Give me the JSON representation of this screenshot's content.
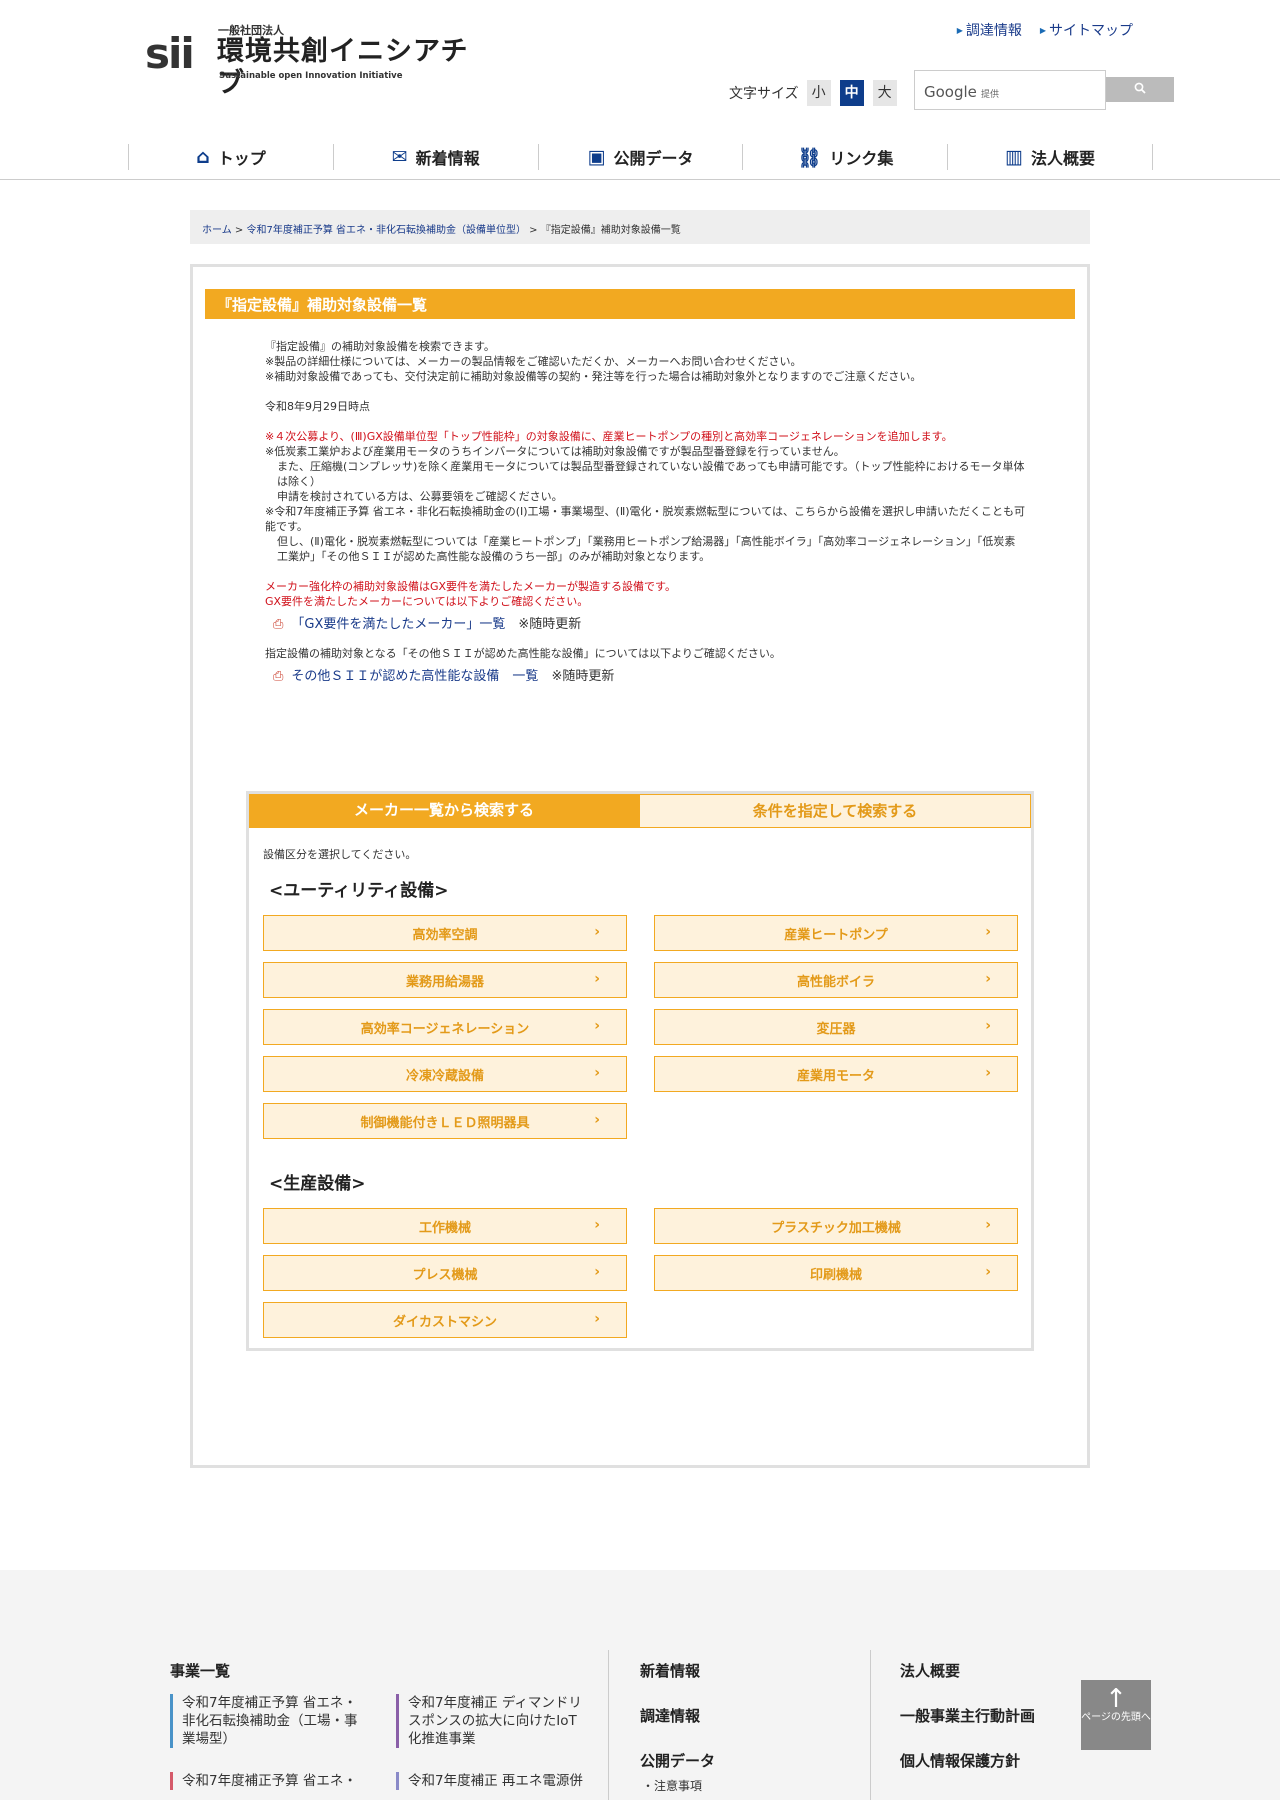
{
  "header": {
    "logo_mark": "sii",
    "logo_sub": "一般社団法人",
    "logo_name": "環境共創イニシアチブ",
    "logo_en": "Sustainable open Innovation Initiative",
    "links": [
      "調達情報",
      "サイトマップ"
    ],
    "font_size_label": "文字サイズ",
    "font_sizes": [
      "小",
      "中",
      "大"
    ],
    "font_size_selected": "中",
    "search_brand": "Google",
    "search_provided": "提供",
    "search_button_icon": "search-icon"
  },
  "nav": [
    {
      "label": "トップ",
      "icon": "home-icon"
    },
    {
      "label": "新着情報",
      "icon": "mail-icon"
    },
    {
      "label": "公開データ",
      "icon": "monitor-icon"
    },
    {
      "label": "リンク集",
      "icon": "link-icon"
    },
    {
      "label": "法人概要",
      "icon": "building-icon"
    }
  ],
  "breadcrumb": [
    "ホーム",
    "令和7年度補正予算 省エネ・非化石転換補助金（設備単位型）",
    "『指定設備』補助対象設備一覧"
  ],
  "page_title": "『指定設備』補助対象設備一覧",
  "intro": {
    "line1": "『指定設備』の補助対象設備を検索できます。",
    "line2": "※製品の詳細仕様については、メーカーの製品情報をご確認いただくか、メーカーへお問い合わせください。",
    "line3": "※補助対象設備であっても、交付決定前に補助対象設備等の契約・発注等を行った場合は補助対象外となりますのでご注意ください。",
    "date": "令和8年9月29日時点",
    "red1": "※４次公募より、(Ⅲ)GX設備単位型「トップ性能枠」の対象設備に、産業ヒートポンプの種別と高効率コージェネレーションを追加します。",
    "note1a": "※低炭素工業炉および産業用モータのうちインバータについては補助対象設備ですが製品型番登録を行っていません。",
    "note1b": "また、圧縮機(コンプレッサ)を除く産業用モータについては製品型番登録されていない設備であっても申請可能です。（トップ性能枠におけるモータ単体は除く）",
    "note1c": "申請を検討されている方は、公募要領をご確認ください。",
    "note2a": "※令和7年度補正予算 省エネ・非化石転換補助金の(Ⅰ)工場・事業場型、(Ⅱ)電化・脱炭素燃転型については、こちらから設備を選択し申請いただくことも可能です。",
    "note2b": "但し、(Ⅱ)電化・脱炭素燃転型については「産業ヒートポンプ」「業務用ヒートポンプ給湯器」「高性能ボイラ」「高効率コージェネレーション」「低炭素工業炉」「その他ＳＩＩが認めた高性能な設備のうち一部」のみが補助対象となります。",
    "red2a": "メーカー強化枠の補助対象設備はGX要件を満たしたメーカーが製造する設備です。",
    "red2b": "GX要件を満たしたメーカーについては以下よりご確認ください。",
    "pdf1_label": "「GX要件を満たしたメーカー」一覧",
    "pdf1_note": "※随時更新",
    "line4": "指定設備の補助対象となる「その他ＳＩＩが認めた高性能な設備」については以下よりご確認ください。",
    "pdf2_label": "その他ＳＩＩが認めた高性能な設備　一覧",
    "pdf2_note": "※随時更新"
  },
  "search": {
    "tab_active": "メーカー一覧から検索する",
    "tab_inactive": "条件を指定して検索する",
    "instruction": "設備区分を選択してください。",
    "group1_title": "<ユーティリティ設備>",
    "group1": [
      "高効率空調",
      "産業ヒートポンプ",
      "業務用給湯器",
      "高性能ボイラ",
      "高効率コージェネレーション",
      "変圧器",
      "冷凍冷蔵設備",
      "産業用モータ",
      "制御機能付きＬＥＤ照明器具"
    ],
    "group2_title": "<生産設備>",
    "group2": [
      "工作機械",
      "プラスチック加工機械",
      "プレス機械",
      "印刷機械",
      "ダイカストマシン"
    ]
  },
  "footer": {
    "col1_title": "事業一覧",
    "col1_items": [
      "令和7年度補正予算 省エネ・非化石転換補助金（工場・事業場型）",
      "令和7年度補正 ディマンドリスポンスの拡大に向けたIoT化推進事業",
      "令和7年度補正予算 省エネ・",
      "令和7年度補正 再エネ電源併"
    ],
    "col2_items": [
      "新着情報",
      "調達情報",
      "公開データ"
    ],
    "col2_sub": "・注意事項",
    "col3_items": [
      "法人概要",
      "一般事業主行動計画",
      "個人情報保護方針"
    ],
    "totop_label": "ページの先頭へ"
  }
}
